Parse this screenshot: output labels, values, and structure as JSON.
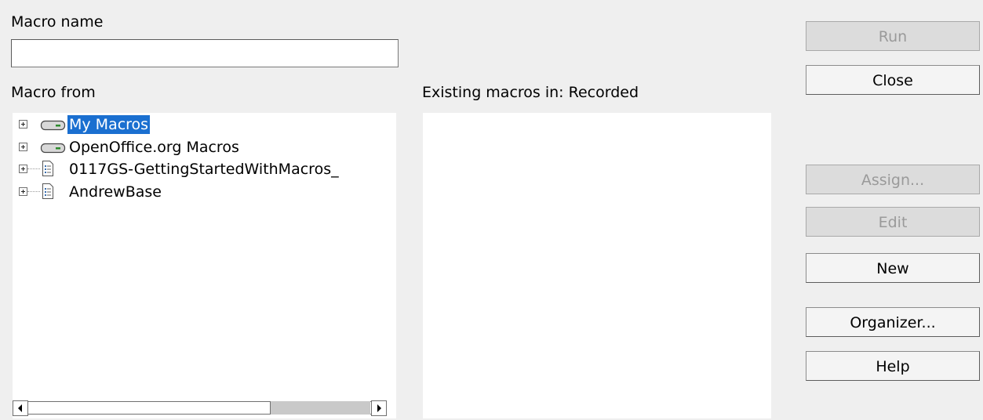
{
  "dialog": {
    "macro_name_label": "Macro name",
    "macro_name_value": "",
    "macro_from_label": "Macro from",
    "existing_macros_label": "Existing macros in: Recorded"
  },
  "tree": {
    "items": [
      {
        "label": "My Macros",
        "icon": "drive-icon",
        "selected": true
      },
      {
        "label": "OpenOffice.org Macros",
        "icon": "drive-icon",
        "selected": false
      },
      {
        "label": "0117GS-GettingStartedWithMacros_",
        "icon": "document-icon",
        "selected": false
      },
      {
        "label": "AndrewBase",
        "icon": "document-icon",
        "selected": false
      }
    ]
  },
  "buttons": {
    "run": "Run",
    "close": "Close",
    "assign": "Assign...",
    "edit": "Edit",
    "new": "New",
    "organizer": "Organizer...",
    "help": "Help"
  },
  "colors": {
    "selection": "#1a6fd0",
    "dialog_bg": "#efefef",
    "disabled_text": "#9a9a9a"
  }
}
